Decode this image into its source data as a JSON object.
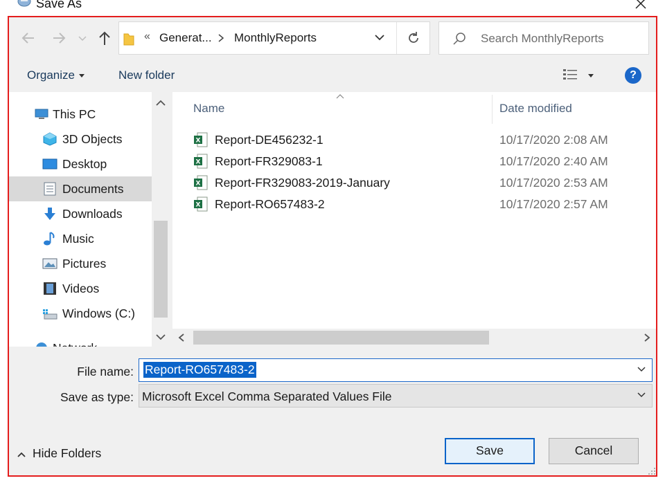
{
  "window": {
    "title": "Save As"
  },
  "address": {
    "overflow": "«",
    "crumbs": [
      "Generat...",
      "MonthlyReports"
    ]
  },
  "search": {
    "placeholder": "Search MonthlyReports"
  },
  "toolbar": {
    "organize_label": "Organize",
    "new_folder_label": "New folder",
    "help": "?"
  },
  "nav": {
    "items": [
      {
        "label": "This PC",
        "icon": "pc-icon"
      },
      {
        "label": "3D Objects",
        "icon": "cube-icon"
      },
      {
        "label": "Desktop",
        "icon": "desktop-icon"
      },
      {
        "label": "Documents",
        "icon": "documents-icon",
        "selected": true
      },
      {
        "label": "Downloads",
        "icon": "download-arrow-icon"
      },
      {
        "label": "Music",
        "icon": "music-note-icon"
      },
      {
        "label": "Pictures",
        "icon": "pictures-icon"
      },
      {
        "label": "Videos",
        "icon": "film-icon"
      },
      {
        "label": "Windows (C:)",
        "icon": "drive-icon"
      },
      {
        "label": "Network",
        "icon": "network-icon"
      }
    ]
  },
  "files": {
    "columns": {
      "name": "Name",
      "date": "Date modified"
    },
    "rows": [
      {
        "name": "Report-DE456232-1",
        "date": "10/17/2020 2:08 AM"
      },
      {
        "name": "Report-FR329083-1",
        "date": "10/17/2020 2:40 AM"
      },
      {
        "name": "Report-FR329083-2019-January",
        "date": "10/17/2020 2:53 AM"
      },
      {
        "name": "Report-RO657483-2",
        "date": "10/17/2020 2:57 AM"
      }
    ]
  },
  "form": {
    "file_name_label": "File name:",
    "file_name_value": "Report-RO657483-2",
    "save_type_label": "Save as type:",
    "save_type_value": "Microsoft Excel Comma Separated Values File"
  },
  "footer": {
    "hide_folders_label": "Hide Folders",
    "save_label": "Save",
    "cancel_label": "Cancel"
  },
  "colors": {
    "accent": "#0a63c9",
    "highlight_border": "#e41c1c",
    "excel_green": "#1e7145"
  }
}
